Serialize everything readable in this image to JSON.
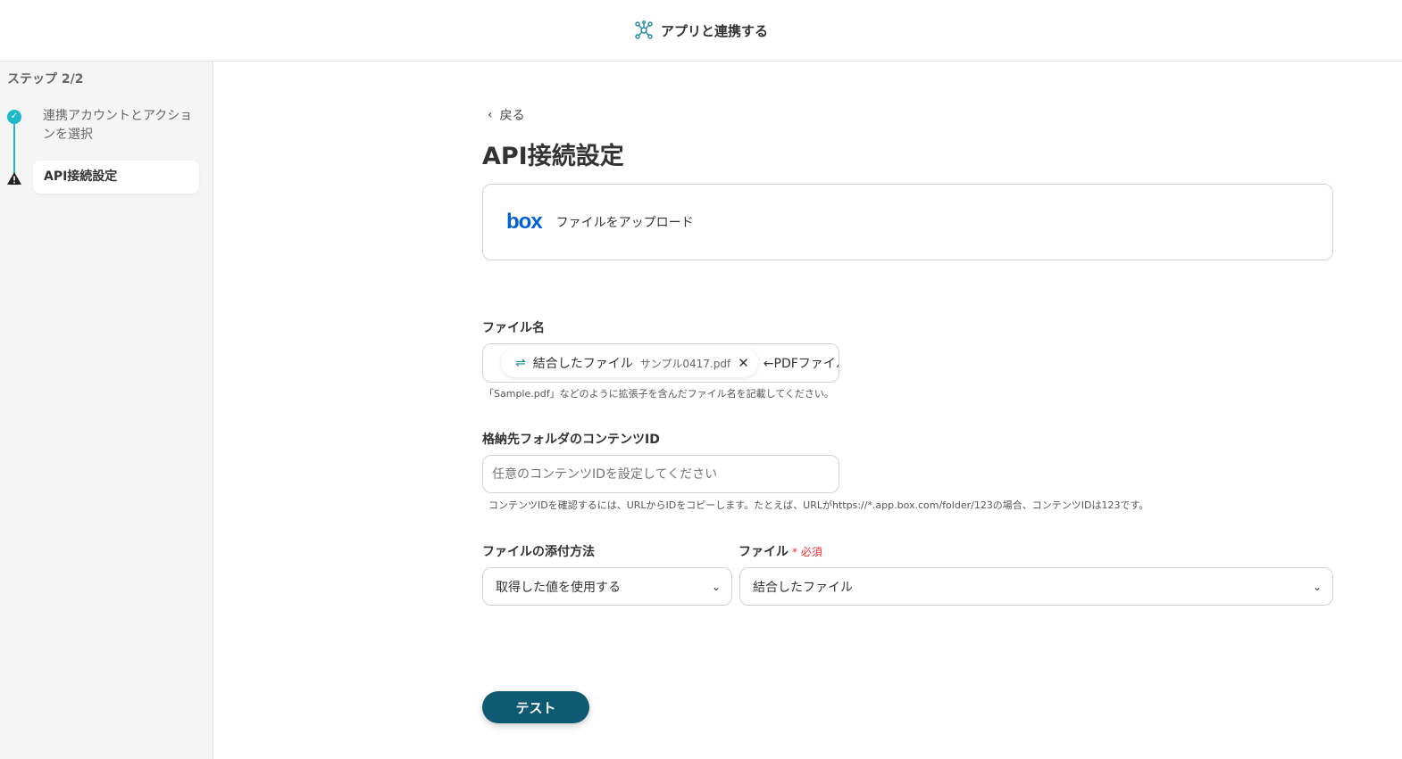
{
  "header": {
    "title": "アプリと連携する",
    "icon": "network-icon"
  },
  "sidebar": {
    "step_count": "ステップ 2/2",
    "steps": [
      {
        "label": "連携アカウントとアクションを選択",
        "status": "done"
      },
      {
        "label": "API接続設定",
        "status": "warning"
      }
    ]
  },
  "main": {
    "back_label": "戻る",
    "page_title": "API接続設定",
    "app": {
      "name": "box",
      "action": "ファイルをアップロード"
    },
    "file_name": {
      "label": "ファイル名",
      "chip_label": "結合したファイル",
      "chip_value": "サンプル0417.pdf",
      "suffix_text": "←PDFファイル",
      "hint": "「Sample.pdf」などのように拡張子を含んだファイル名を記載してください。"
    },
    "folder_id": {
      "label": "格納先フォルダのコンテンツID",
      "placeholder": "任意のコンテンツIDを設定してください",
      "hint": "コンテンツIDを確認するには、URLからIDをコピーします。たとえば、URLがhttps://*.app.box.com/folder/123の場合、コンテンツIDは123です。"
    },
    "attach_method": {
      "label": "ファイルの添付方法",
      "value": "取得した値を使用する"
    },
    "file": {
      "label": "ファイル",
      "required": "必須",
      "value": "結合したファイル"
    },
    "test_button": "テスト"
  }
}
